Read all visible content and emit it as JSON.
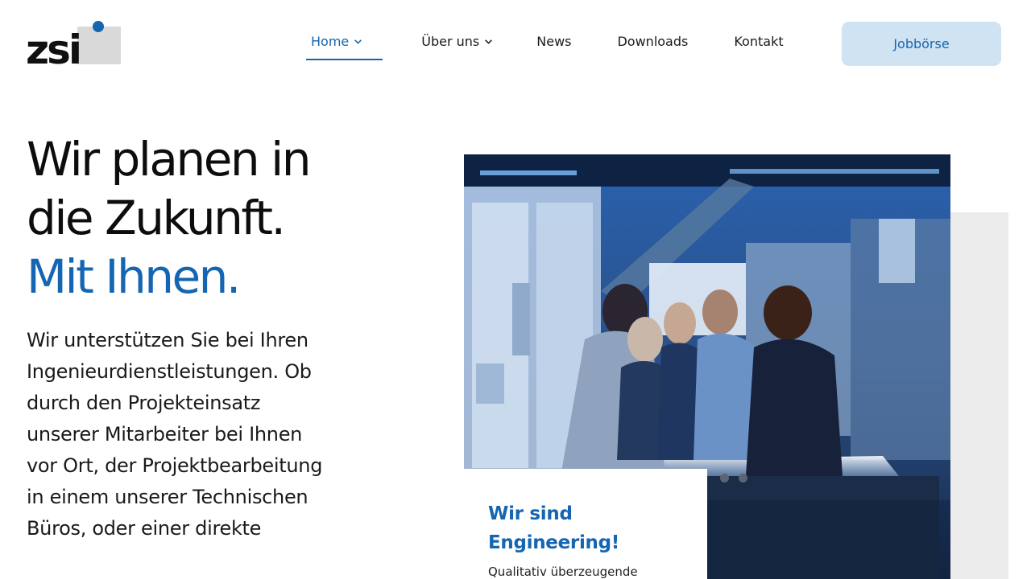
{
  "logo": {
    "text": "zsi"
  },
  "nav": {
    "items": [
      {
        "label": "Home",
        "has_dropdown": true,
        "active": true
      },
      {
        "label": "Über uns",
        "has_dropdown": true,
        "active": false
      },
      {
        "label": "News",
        "has_dropdown": false,
        "active": false
      },
      {
        "label": "Downloads",
        "has_dropdown": false,
        "active": false
      },
      {
        "label": "Kontakt",
        "has_dropdown": false,
        "active": false
      }
    ],
    "cta_label": "Jobbörse"
  },
  "hero": {
    "title_line1": "Wir planen in",
    "title_line2": "die Zukunft.",
    "title_line3": "Mit Ihnen.",
    "body": "Wir unterstützen Sie bei Ihren Ingenieurdienstleistungen. Ob durch den Projekteinsatz unserer Mitarbeiter bei Ihnen vor Ort, der Projektbearbeitung in einem unserer Technischen Büros, oder einer direkte"
  },
  "card": {
    "title": "Wir sind Engineering!",
    "text": "Qualitativ überzeugende"
  },
  "slider": {
    "dot_count": 2
  },
  "colors": {
    "accent": "#1565b0",
    "cta_bg": "#cfe3f3",
    "photo_tint": "#1d3f73",
    "gray_block": "#ececec"
  }
}
